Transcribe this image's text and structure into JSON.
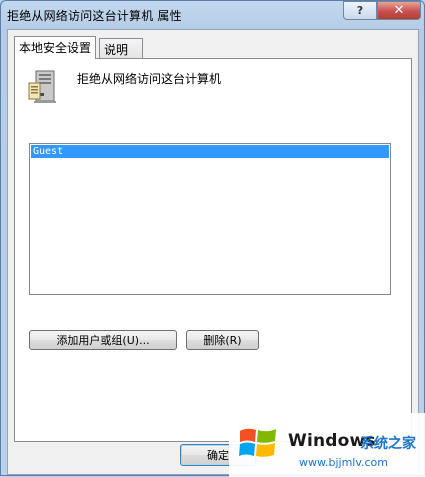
{
  "window": {
    "title": "拒绝从网络访问这台计算机 属性",
    "help_label": "?",
    "close_label": "✕"
  },
  "tabs": [
    {
      "label": "本地安全设置",
      "active": true
    },
    {
      "label": "说明",
      "active": false
    }
  ],
  "policy": {
    "icon": "computer-tower-icon",
    "name": "拒绝从网络访问这台计算机"
  },
  "list": {
    "items": [
      "Guest"
    ],
    "selected_index": 0,
    "selection_color": "#3399ff"
  },
  "buttons": {
    "add_label": "添加用户或组(U)...",
    "remove_label": "删除(R)",
    "ok_label": "确定"
  },
  "watermark": {
    "brand": "Windows",
    "brand_cn": "系统之家",
    "url": "www.bjjmlv.com"
  },
  "colors": {
    "frame": "#b9d1ea",
    "close_button": "#c75050",
    "selection": "#3399ff"
  }
}
